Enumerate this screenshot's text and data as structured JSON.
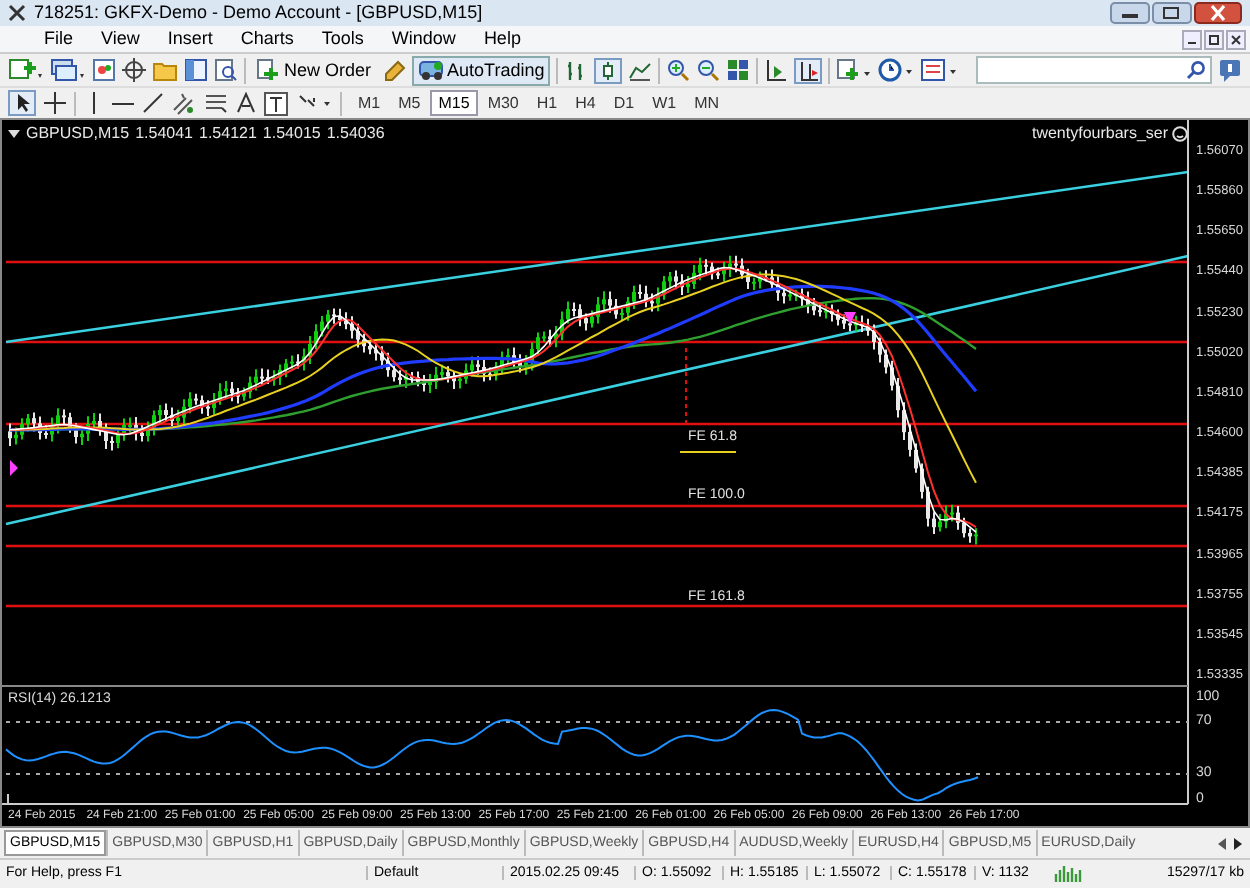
{
  "window": {
    "title": "718251: GKFX-Demo - Demo Account - [GBPUSD,M15]"
  },
  "menu": [
    "File",
    "View",
    "Insert",
    "Charts",
    "Tools",
    "Window",
    "Help"
  ],
  "toolbar": {
    "new_order": "New Order",
    "autotrading": {
      "label": "AutoTrading",
      "on": true
    }
  },
  "timeframes": [
    {
      "label": "M1",
      "selected": false
    },
    {
      "label": "M5",
      "selected": false
    },
    {
      "label": "M15",
      "selected": true
    },
    {
      "label": "M30",
      "selected": false
    },
    {
      "label": "H1",
      "selected": false
    },
    {
      "label": "H4",
      "selected": false
    },
    {
      "label": "D1",
      "selected": false
    },
    {
      "label": "W1",
      "selected": false
    },
    {
      "label": "MN",
      "selected": false
    }
  ],
  "chart": {
    "symbol": "GBPUSD,M15",
    "ohlc": [
      "1.54041",
      "1.54121",
      "1.54015",
      "1.54036"
    ],
    "expert": "twentyfourbars_ser",
    "price_ticks": [
      "1.56070",
      "1.55860",
      "1.55650",
      "1.55440",
      "1.55230",
      "1.55020",
      "1.54810",
      "1.54600",
      "1.54385",
      "1.54175",
      "1.53965",
      "1.53755",
      "1.53545",
      "1.53335"
    ],
    "fibo_labels": [
      "FE 61.8",
      "FE 100.0",
      "FE 161.8"
    ],
    "time_labels": [
      "24 Feb 2015",
      "24 Feb 21:00",
      "25 Feb 01:00",
      "25 Feb 05:00",
      "25 Feb 09:00",
      "25 Feb 13:00",
      "25 Feb 17:00",
      "25 Feb 21:00",
      "26 Feb 01:00",
      "26 Feb 05:00",
      "26 Feb 09:00",
      "26 Feb 13:00",
      "26 Feb 17:00"
    ]
  },
  "rsi": {
    "label": "RSI(14) 26.1213",
    "ticks": [
      "100",
      "70",
      "30",
      "0"
    ]
  },
  "tabs": [
    {
      "label": "GBPUSD,M15",
      "selected": true
    },
    {
      "label": "GBPUSD,M30",
      "selected": false
    },
    {
      "label": "GBPUSD,H1",
      "selected": false
    },
    {
      "label": "GBPUSD,Daily",
      "selected": false
    },
    {
      "label": "GBPUSD,Monthly",
      "selected": false
    },
    {
      "label": "GBPUSD,Weekly",
      "selected": false
    },
    {
      "label": "GBPUSD,H4",
      "selected": false
    },
    {
      "label": "AUDUSD,Weekly",
      "selected": false
    },
    {
      "label": "EURUSD,H4",
      "selected": false
    },
    {
      "label": "GBPUSD,M5",
      "selected": false
    },
    {
      "label": "EURUSD,Daily",
      "selected": false
    }
  ],
  "status_bar": {
    "help": "For Help, press F1",
    "profile": "Default",
    "time": "2015.02.25 09:45",
    "open": "O: 1.55092",
    "high": "H: 1.55185",
    "low": "L: 1.55072",
    "close": "C: 1.55178",
    "volume": "V: 1132",
    "traffic": "15297/17 kb"
  }
}
